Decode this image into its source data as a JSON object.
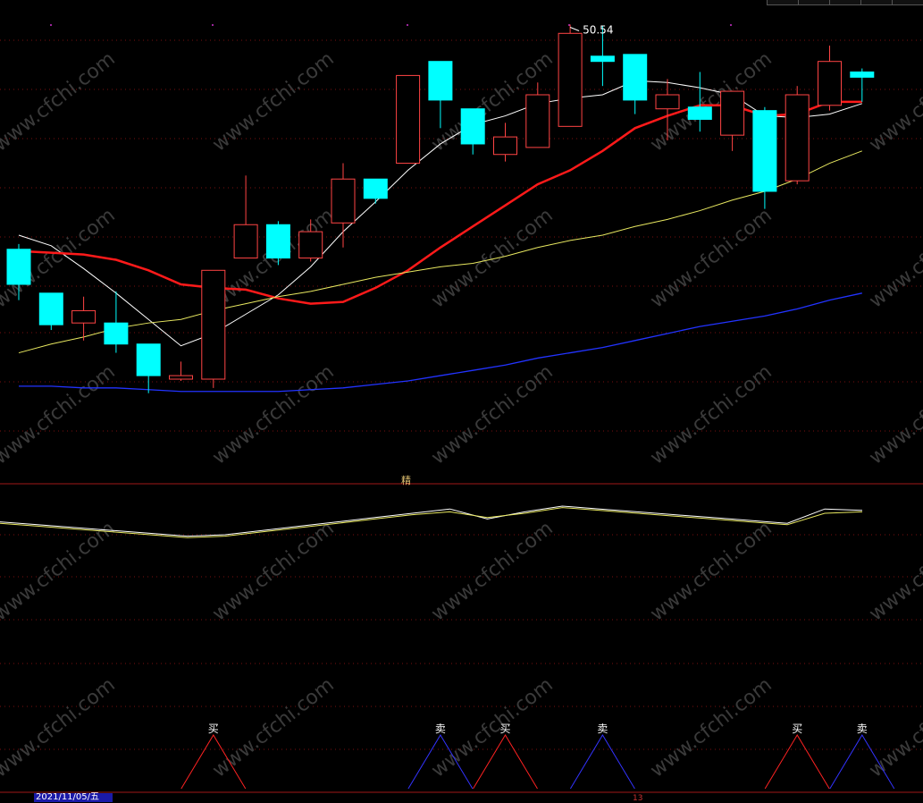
{
  "panel_label": "精",
  "max_price_label": "50.54",
  "date_label": "2021/11/05/五",
  "date_aux": "13",
  "watermark": "www.cfchi.com",
  "colors": {
    "up": "#ff4444",
    "down": "#00ffff",
    "ma_white": "#ffffff",
    "ma_red": "#ff1a1a",
    "ma_yellow": "#e8e860",
    "ma_blue": "#2233ff",
    "grid": "#7a1010",
    "buy_signal": "#ff2222",
    "sell_signal": "#3333ff",
    "signal_text": "#ffffff"
  },
  "chart_data": [
    {
      "type": "candlestick",
      "panel": "price",
      "ylim": [
        25.0,
        52.0
      ],
      "candles": [
        {
          "o": 37.8,
          "h": 38.1,
          "c": 35.8,
          "l": 34.9
        },
        {
          "o": 35.3,
          "h": 35.3,
          "c": 33.5,
          "l": 33.2
        },
        {
          "o": 33.6,
          "h": 35.1,
          "c": 34.3,
          "l": 32.6
        },
        {
          "o": 33.6,
          "h": 35.4,
          "c": 32.4,
          "l": 31.9
        },
        {
          "o": 32.4,
          "h": 32.4,
          "c": 30.6,
          "l": 29.6
        },
        {
          "o": 30.4,
          "h": 31.4,
          "c": 30.6,
          "l": 30.3
        },
        {
          "o": 30.4,
          "h": 36.6,
          "c": 36.6,
          "l": 29.9
        },
        {
          "o": 37.3,
          "h": 42.0,
          "c": 39.2,
          "l": 37.3
        },
        {
          "o": 39.2,
          "h": 39.4,
          "c": 37.3,
          "l": 36.9
        },
        {
          "o": 37.3,
          "h": 39.5,
          "c": 38.8,
          "l": 37.1
        },
        {
          "o": 39.3,
          "h": 42.7,
          "c": 41.8,
          "l": 37.9
        },
        {
          "o": 41.8,
          "h": 41.8,
          "c": 40.7,
          "l": 40.4
        },
        {
          "o": 42.7,
          "h": 47.1,
          "c": 47.7,
          "l": 42.7
        },
        {
          "o": 48.5,
          "h": 48.5,
          "c": 46.3,
          "l": 44.7
        },
        {
          "o": 45.8,
          "h": 45.8,
          "c": 43.8,
          "l": 43.2
        },
        {
          "o": 43.2,
          "h": 45.0,
          "c": 44.2,
          "l": 42.8
        },
        {
          "o": 43.6,
          "h": 47.3,
          "c": 46.6,
          "l": 43.6
        },
        {
          "o": 44.8,
          "h": 50.6,
          "c": 50.1,
          "l": 44.8
        },
        {
          "o": 48.8,
          "h": 50.54,
          "c": 48.5,
          "l": 47.1
        },
        {
          "o": 48.9,
          "h": 48.9,
          "c": 46.3,
          "l": 45.5
        },
        {
          "o": 45.8,
          "h": 47.5,
          "c": 46.6,
          "l": 44.0
        },
        {
          "o": 45.9,
          "h": 47.9,
          "c": 45.2,
          "l": 44.5
        },
        {
          "o": 44.3,
          "h": 46.8,
          "c": 46.8,
          "l": 43.4
        },
        {
          "o": 45.7,
          "h": 45.9,
          "c": 41.1,
          "l": 40.1
        },
        {
          "o": 41.7,
          "h": 47.1,
          "c": 46.6,
          "l": 41.5
        },
        {
          "o": 46.0,
          "h": 49.4,
          "c": 48.5,
          "l": 45.7
        },
        {
          "o": 47.9,
          "h": 48.1,
          "c": 47.6,
          "l": 46.2
        }
      ],
      "ma": [
        {
          "color_key": "ma_white",
          "values": [
            38.6,
            38.0,
            36.7,
            35.3,
            33.8,
            32.3,
            33.0,
            34.1,
            35.2,
            36.8,
            38.8,
            40.5,
            42.3,
            43.8,
            44.9,
            45.4,
            46.1,
            46.4,
            46.6,
            47.4,
            47.3,
            47.0,
            46.6,
            45.4,
            45.3,
            45.5,
            46.1
          ]
        },
        {
          "color_key": "ma_red",
          "values": [
            37.7,
            37.6,
            37.5,
            37.2,
            36.6,
            35.8,
            35.6,
            35.5,
            35.0,
            34.7,
            34.8,
            35.6,
            36.6,
            37.9,
            39.1,
            40.3,
            41.5,
            42.3,
            43.4,
            44.7,
            45.4,
            46.0,
            46.0,
            45.4,
            45.5,
            46.2,
            46.2
          ]
        },
        {
          "color_key": "ma_yellow",
          "values": [
            31.9,
            32.4,
            32.8,
            33.3,
            33.6,
            33.8,
            34.3,
            34.7,
            35.1,
            35.4,
            35.8,
            36.2,
            36.5,
            36.8,
            37.0,
            37.4,
            37.9,
            38.3,
            38.6,
            39.1,
            39.5,
            40.0,
            40.6,
            41.1,
            41.8,
            42.7,
            43.4
          ]
        },
        {
          "color_key": "ma_blue",
          "values": [
            30.0,
            30.0,
            29.9,
            29.9,
            29.8,
            29.7,
            29.7,
            29.7,
            29.7,
            29.8,
            29.9,
            30.1,
            30.3,
            30.6,
            30.9,
            31.2,
            31.6,
            31.9,
            32.2,
            32.6,
            33.0,
            33.4,
            33.7,
            34.0,
            34.4,
            34.9,
            35.3
          ]
        }
      ]
    },
    {
      "type": "line",
      "panel": "indicator",
      "ylim": [
        0,
        100
      ],
      "series": [
        {
          "color_key": "ma_white",
          "values": [
            79,
            77,
            75,
            73,
            71,
            69,
            70,
            73,
            76,
            79,
            82,
            85,
            88,
            81,
            86,
            90,
            88,
            86,
            84,
            82,
            80,
            78,
            88,
            87
          ]
        },
        {
          "color_key": "ma_yellow",
          "values": [
            78,
            76,
            74,
            72,
            70,
            68,
            69,
            72,
            75,
            78,
            81,
            84,
            86,
            82,
            85,
            89,
            87,
            85,
            83,
            81,
            79,
            77,
            85,
            86
          ]
        }
      ]
    },
    {
      "type": "signals",
      "panel": "signals",
      "signals": [
        {
          "label": "买",
          "kind": "buy",
          "candle": 6
        },
        {
          "label": "卖",
          "kind": "sell",
          "candle": 13
        },
        {
          "label": "买",
          "kind": "buy",
          "candle": 15
        },
        {
          "label": "卖",
          "kind": "sell",
          "candle": 18
        },
        {
          "label": "买",
          "kind": "buy",
          "candle": 24
        },
        {
          "label": "卖",
          "kind": "sell",
          "candle": 26
        }
      ]
    }
  ]
}
